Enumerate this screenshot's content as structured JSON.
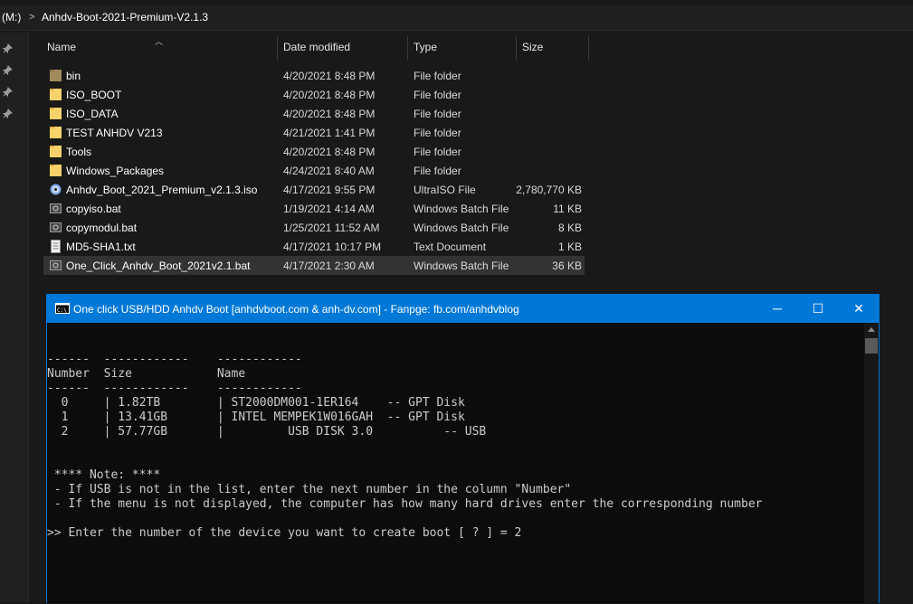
{
  "address": {
    "drive": "(M:)",
    "separator": ">",
    "folder": "Anhdv-Boot-2021-Premium-V2.1.3"
  },
  "columns": {
    "name": "Name",
    "date": "Date modified",
    "type": "Type",
    "size": "Size"
  },
  "files": [
    {
      "name": "bin",
      "date": "4/20/2021 8:48 PM",
      "type": "File folder",
      "size": "",
      "icon": "folder-dark-icon"
    },
    {
      "name": "ISO_BOOT",
      "date": "4/20/2021 8:48 PM",
      "type": "File folder",
      "size": "",
      "icon": "folder-icon"
    },
    {
      "name": "ISO_DATA",
      "date": "4/20/2021 8:48 PM",
      "type": "File folder",
      "size": "",
      "icon": "folder-icon"
    },
    {
      "name": "TEST ANHDV V213",
      "date": "4/21/2021 1:41 PM",
      "type": "File folder",
      "size": "",
      "icon": "folder-icon"
    },
    {
      "name": "Tools",
      "date": "4/20/2021 8:48 PM",
      "type": "File folder",
      "size": "",
      "icon": "folder-icon"
    },
    {
      "name": "Windows_Packages",
      "date": "4/24/2021 8:40 AM",
      "type": "File folder",
      "size": "",
      "icon": "folder-icon"
    },
    {
      "name": "Anhdv_Boot_2021_Premium_v2.1.3.iso",
      "date": "4/17/2021 9:55 PM",
      "type": "UltraISO File",
      "size": "2,780,770 KB",
      "icon": "disc-icon"
    },
    {
      "name": "copyiso.bat",
      "date": "1/19/2021 4:14 AM",
      "type": "Windows Batch File",
      "size": "11 KB",
      "icon": "batch-file-icon"
    },
    {
      "name": "copymodul.bat",
      "date": "1/25/2021 11:52 AM",
      "type": "Windows Batch File",
      "size": "8 KB",
      "icon": "batch-file-icon"
    },
    {
      "name": "MD5-SHA1.txt",
      "date": "4/17/2021 10:17 PM",
      "type": "Text Document",
      "size": "1 KB",
      "icon": "text-file-icon"
    },
    {
      "name": "One_Click_Anhdv_Boot_2021v2.1.bat",
      "date": "4/17/2021 2:30 AM",
      "type": "Windows Batch File",
      "size": "36 KB",
      "icon": "batch-file-icon",
      "selected": true
    }
  ],
  "console": {
    "title": "One click USB/HDD Anhdv Boot [anhdvboot.com & anh-dv.com] -  Fanpge: fb.com/anhdvblog",
    "minimize": "─",
    "maximize": "☐",
    "close": "✕",
    "lines": [
      "------  ------------    ------------",
      "Number  Size            Name",
      "------  ------------    ------------",
      "  0     | 1.82TB        | ST2000DM001-1ER164    -- GPT Disk",
      "  1     | 13.41GB       | INTEL MEMPEK1W016GAH  -- GPT Disk",
      "  2     | 57.77GB       |         USB DISK 3.0          -- USB",
      "",
      "",
      " **** Note: ****",
      " - If USB is not in the list, enter the next number in the column \"Number\"",
      " - If the menu is not displayed, the computer has how many hard drives enter the corresponding number",
      "",
      ">> Enter the number of the device you want to create boot [ ? ] = 2"
    ]
  },
  "colors": {
    "accent": "#0078d7",
    "folder": "#f7d26a",
    "console_bg": "#0c0c0c"
  }
}
